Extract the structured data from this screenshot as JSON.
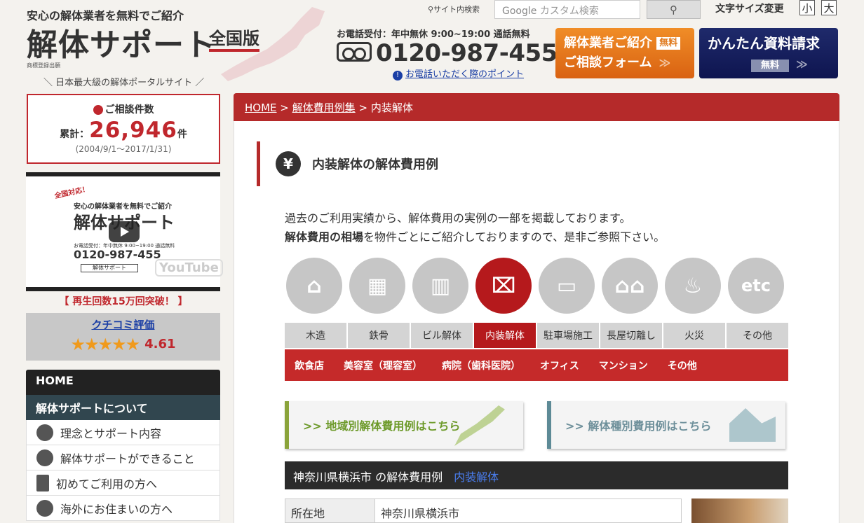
{
  "header": {
    "catch": "安心の解体業者を無料でご紹介",
    "logo": "解体サポート",
    "edition": "全国版",
    "trademark": "商標登録出願",
    "tagline": "＼ 日本最大級の解体ポータルサイト ／",
    "site_search_label": "サイト内検索",
    "search_placeholder": "カスタム検索",
    "search_brand": "Google",
    "font_size_label": "文字サイズ変更",
    "font_small": "小",
    "font_large": "大",
    "tel_hours": "お電話受付：年中無休 9:00~19:00 通話無料",
    "tel_number": "0120-987-455",
    "tel_point": "お電話いただく際のポイント",
    "cta_consult_line1": "解体業者ご紹介",
    "cta_consult_free": "無料",
    "cta_consult_line2": "ご相談フォーム",
    "cta_docs_line1": "かんたん資料請求",
    "cta_docs_free": "無料"
  },
  "sidebar": {
    "counter_label": "ご相談件数",
    "counter_prefix": "累計：",
    "counter_value": "26,946",
    "counter_unit": "件",
    "counter_period": "(2004/9/1〜2017/1/31)",
    "video": {
      "badge": "全国対応！",
      "catch": "安心の解体業者を無料でご紹介",
      "logo": "解体サポート",
      "tel_small": "お電話受付：年中無休 9:00~19:00 通話無料",
      "tel": "0120-987-455",
      "search_box": "解体サポート",
      "yt": "YouTube"
    },
    "plays": "【 再生回数15万回突破！ 】",
    "review_title": "クチコミ評価",
    "review_stars": "★★★★★",
    "review_score": "4.61",
    "menu": {
      "home": "HOME",
      "about": "解体サポートについて",
      "items": [
        "理念とサポート内容",
        "解体サポートができること",
        "初めてご利用の方へ",
        "海外にお住まいの方へ"
      ]
    }
  },
  "breadcrumb": {
    "home": "HOME",
    "sep": ">",
    "cost": "解体費用例集",
    "current": "内装解体"
  },
  "section_title": "内装解体の解体費用例",
  "intro": {
    "line1": "過去のご利用実績から、解体費用の実例の一部を掲載しております。",
    "line2_bold": "解体費用の相場",
    "line2_rest": "を物件ごとにご紹介しておりますので、是非ご参照下さい。"
  },
  "category_icons": [
    "house-icon",
    "building-icon",
    "office-building-icon",
    "interior-icon",
    "parking-icon",
    "row-house-icon",
    "fire-icon",
    "etc-icon"
  ],
  "tabs": [
    "木造",
    "鉄骨",
    "ビル解体",
    "内装解体",
    "駐車場施工",
    "長屋切離し",
    "火災",
    "その他"
  ],
  "active_tab": "内装解体",
  "subnav": [
    "飲食店",
    "美容室（理容室）",
    "病院（歯科医院）",
    "オフィス",
    "マンション",
    "その他"
  ],
  "banners": {
    "region": ">> 地域別解体費用例はこちら",
    "type": ">> 解体種別費用例はこちら"
  },
  "case": {
    "location_title": "神奈川県横浜市",
    "suffix": "の解体費用例",
    "category": "内装解体"
  },
  "table": {
    "row1_label": "所在地",
    "row1_value": "神奈川県横浜市"
  },
  "colors": {
    "brand_red": "#b52a2a",
    "orange": "#e07a1e",
    "navy": "#0e1550"
  }
}
